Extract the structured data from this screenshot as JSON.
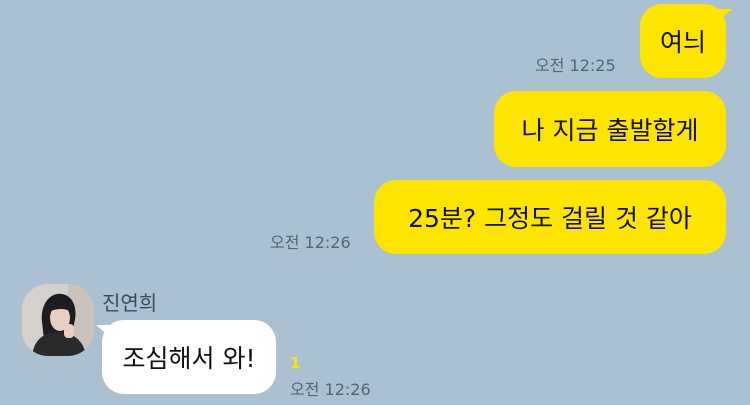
{
  "messages": {
    "m1": {
      "text": "여늬",
      "time": "오전 12:25"
    },
    "m2": {
      "text": "나 지금 출발할게"
    },
    "m3": {
      "text": "25분? 그정도 걸릴 것 같아",
      "time": "오전 12:26"
    },
    "reply": {
      "sender": "진연희",
      "text": "조심해서 와!",
      "unread": "1",
      "time": "오전 12:26"
    }
  },
  "colors": {
    "background": "#abc1d1",
    "mine": "#fee500",
    "theirs": "#ffffff",
    "timestamp": "#56656f"
  },
  "icons": {
    "avatar": "profile-photo-avatar"
  }
}
